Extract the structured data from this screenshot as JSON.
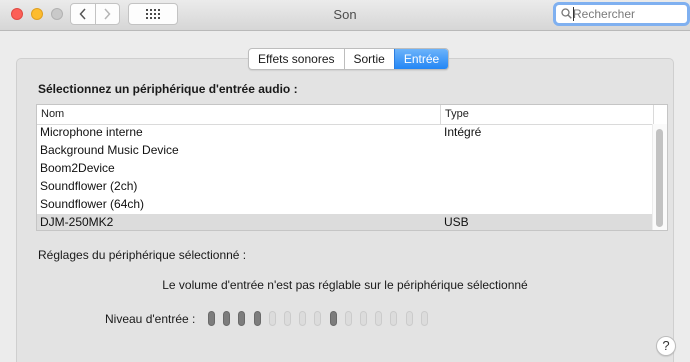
{
  "window": {
    "title": "Son",
    "search_placeholder": "Rechercher"
  },
  "tabs": [
    {
      "label": "Effets sonores",
      "active": false
    },
    {
      "label": "Sortie",
      "active": false
    },
    {
      "label": "Entrée",
      "active": true
    }
  ],
  "input_section": {
    "heading": "Sélectionnez un périphérique d'entrée audio :",
    "columns": [
      "Nom",
      "Type"
    ],
    "devices": [
      {
        "name": "Microphone interne",
        "type": "Intégré",
        "selected": false
      },
      {
        "name": "Background Music Device",
        "type": "",
        "selected": false
      },
      {
        "name": "Boom2Device",
        "type": "",
        "selected": false
      },
      {
        "name": "Soundflower (2ch)",
        "type": "",
        "selected": false
      },
      {
        "name": "Soundflower (64ch)",
        "type": "",
        "selected": false
      },
      {
        "name": "DJM-250MK2",
        "type": "USB",
        "selected": true
      }
    ]
  },
  "settings": {
    "label": "Réglages du périphérique sélectionné :",
    "volume_message": "Le volume d'entrée n'est pas réglable sur le périphérique sélectionné",
    "level_label": "Niveau d'entrée :",
    "level_pills": [
      true,
      true,
      true,
      true,
      false,
      false,
      false,
      false,
      true,
      false,
      false,
      false,
      false,
      false,
      false
    ]
  },
  "help_label": "?",
  "colors": {
    "accent": "#2386f5",
    "search_focus": "#7fb0f0",
    "close": "#fc5f57",
    "minimize": "#fdbc2e"
  }
}
